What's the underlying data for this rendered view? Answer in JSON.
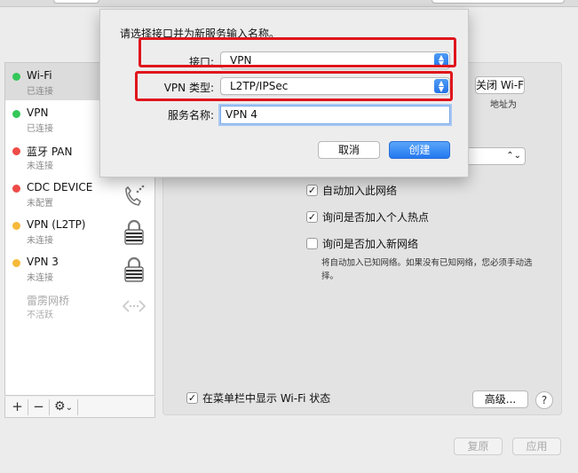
{
  "sidebar": {
    "services": [
      {
        "name": "Wi-Fi",
        "status": "已连接",
        "color": "#34c759",
        "icon": "wifi-icon"
      },
      {
        "name": "VPN",
        "status": "已连接",
        "color": "#34c759",
        "icon": "vpn-icon"
      },
      {
        "name": "蓝牙 PAN",
        "status": "未连接",
        "color": "#ee4b47",
        "icon": "bluetooth-icon"
      },
      {
        "name": "CDC DEVICE",
        "status": "未配置",
        "color": "#ee4b47",
        "icon": "phone-icon"
      },
      {
        "name": "VPN (L2TP)",
        "status": "未连接",
        "color": "#f6b93b",
        "icon": "lock-icon"
      },
      {
        "name": "VPN  3",
        "status": "未连接",
        "color": "#f6b93b",
        "icon": "lock-icon"
      },
      {
        "name": "雷雳网桥",
        "status": "不活跃",
        "color": "",
        "icon": "bridge-icon"
      }
    ],
    "add_label": "+",
    "remove_label": "−",
    "gear_label": "⚙",
    "gear_chevron": "⌄"
  },
  "panel": {
    "turn_off_wifi_label": "关闭 Wi-Fi",
    "address_text": "地址为",
    "auto_join": {
      "label": "自动加入此网络",
      "checked": true
    },
    "ask_hotspot": {
      "label": "询问是否加入个人热点",
      "checked": true
    },
    "ask_new": {
      "label": "询问是否加入新网络",
      "checked": false
    },
    "hint": "将自动加入已知网络。如果没有已知网络，您必须手动选择。",
    "show_wifi_menu": {
      "label": "在菜单栏中显示 Wi-Fi 状态",
      "checked": true
    },
    "advanced_label": "高级...",
    "help_label": "?"
  },
  "footer": {
    "revert_label": "复原",
    "apply_label": "应用"
  },
  "sheet": {
    "title": "请选择接口并为新服务输入名称。",
    "interface_label": "接口:",
    "interface_value": "VPN",
    "vpn_type_label": "VPN 类型:",
    "vpn_type_value": "L2TP/IPSec",
    "service_name_label": "服务名称:",
    "service_name_value": "VPN 4",
    "cancel_label": "取消",
    "create_label": "创建"
  },
  "colors": {
    "highlight": "#e0151c",
    "accent": "#2378f0"
  }
}
